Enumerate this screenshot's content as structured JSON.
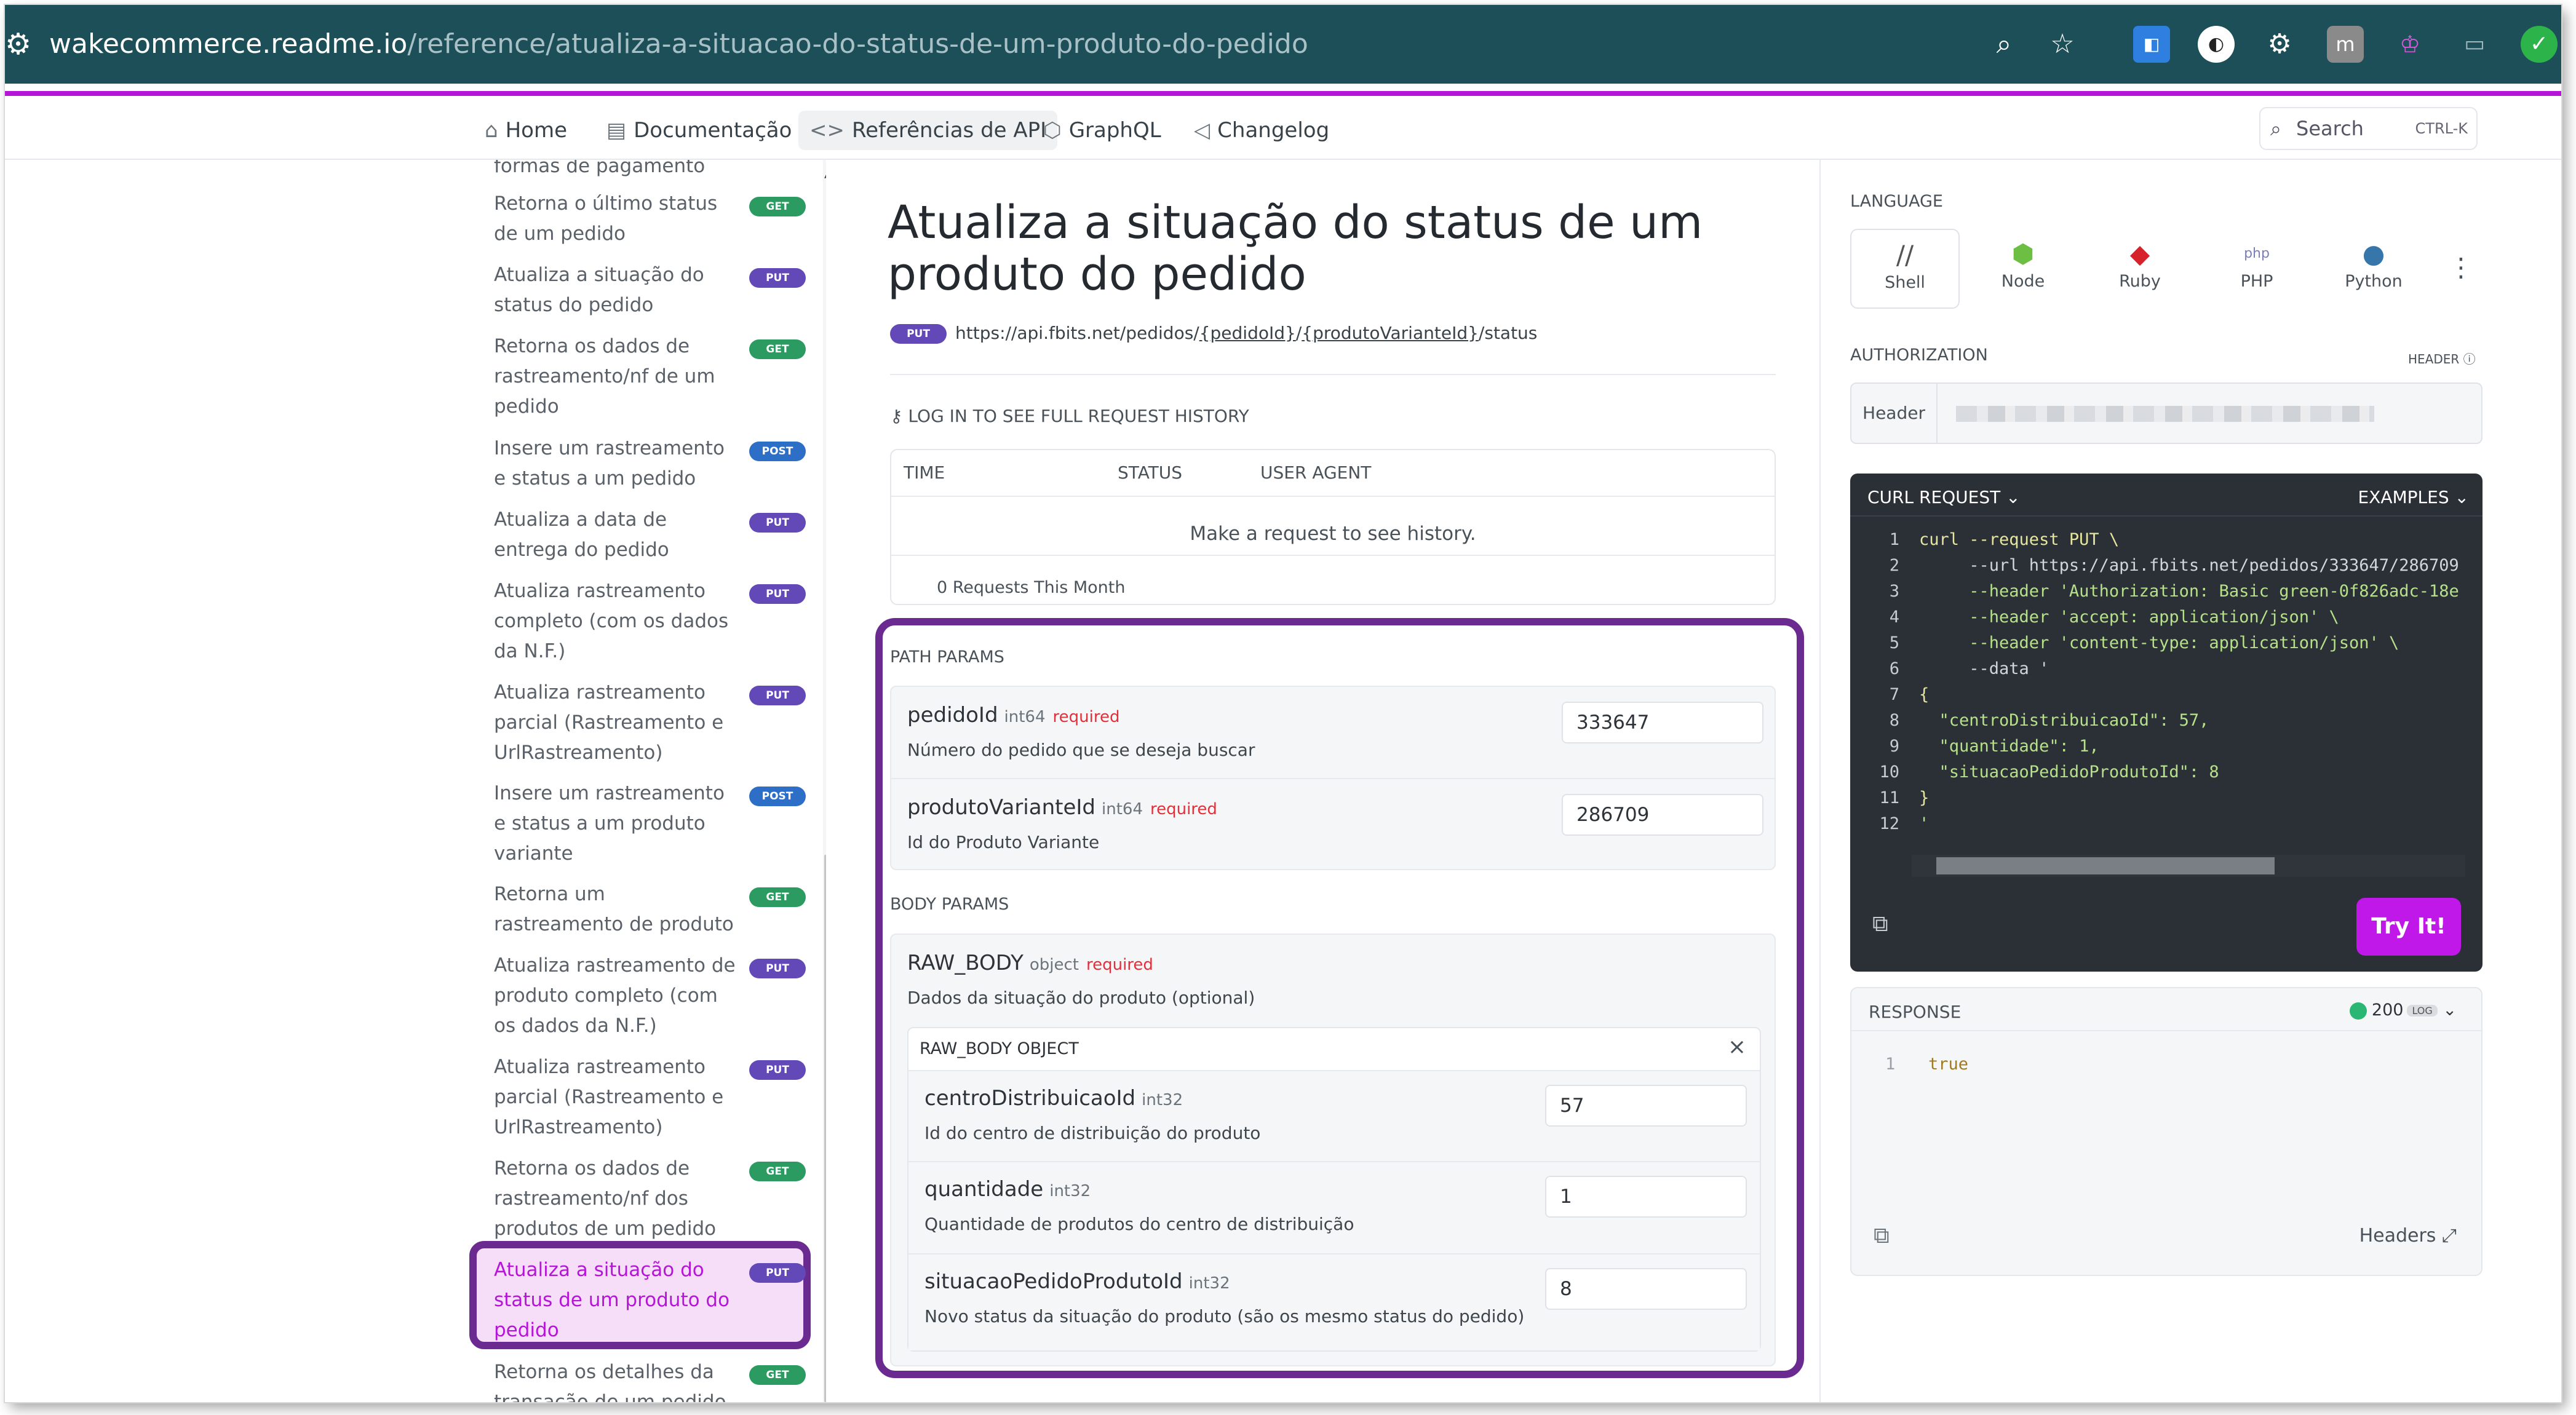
{
  "browser": {
    "url_host": "wakecommerce.readme.io",
    "url_path": "/reference/atualiza-a-situacao-do-status-de-um-produto-do-pedido"
  },
  "nav": {
    "home": "Home",
    "docs": "Documentação",
    "api": "Referências de API",
    "graphql": "GraphQL",
    "changelog": "Changelog",
    "search": "Search",
    "shortcut": "CTRL-K"
  },
  "sidebar": {
    "items": [
      {
        "label": "formas de pagamento",
        "badge": ""
      },
      {
        "label": "Retorna o último status de um pedido",
        "badge": "GET"
      },
      {
        "label": "Atualiza a situação do status do pedido",
        "badge": "PUT"
      },
      {
        "label": "Retorna os dados de rastreamento/nf de um pedido",
        "badge": "GET"
      },
      {
        "label": "Insere um rastreamento e status a um pedido",
        "badge": "POST"
      },
      {
        "label": "Atualiza a data de entrega do pedido",
        "badge": "PUT"
      },
      {
        "label": "Atualiza rastreamento completo (com os dados da N.F.)",
        "badge": "PUT"
      },
      {
        "label": "Atualiza rastreamento parcial (Rastreamento e UrlRastreamento)",
        "badge": "PUT"
      },
      {
        "label": "Insere um rastreamento e status a um produto variante",
        "badge": "POST"
      },
      {
        "label": "Retorna um rastreamento de produto",
        "badge": "GET"
      },
      {
        "label": "Atualiza rastreamento de produto completo (com os dados da N.F.)",
        "badge": "PUT"
      },
      {
        "label": "Atualiza rastreamento parcial (Rastreamento e UrlRastreamento)",
        "badge": "PUT"
      },
      {
        "label": "Retorna os dados de rastreamento/nf dos produtos de um pedido",
        "badge": "GET"
      },
      {
        "label": "Atualiza a situação do status de um produto do pedido",
        "badge": "PUT"
      },
      {
        "label": "Retorna os detalhes da transação de um pedido",
        "badge": "GET"
      }
    ]
  },
  "main": {
    "title": "Atualiza a situação do status de um produto do pedido",
    "method": "PUT",
    "url_base": "https://api.fbits.net/pedidos/",
    "url_p1": "{pedidoId}",
    "url_sep": "/",
    "url_p2": "{produtoVarianteId}",
    "url_end": "/status",
    "login_notice": "LOG IN TO SEE FULL REQUEST HISTORY",
    "history": {
      "col_time": "TIME",
      "col_status": "STATUS",
      "col_agent": "USER AGENT",
      "empty": "Make a request to see history.",
      "count": "0 Requests This Month"
    },
    "path_params_label": "PATH PARAMS",
    "path_params": [
      {
        "name": "pedidoId",
        "type": "int64",
        "req": "required",
        "desc": "Número do pedido que se deseja buscar",
        "value": "333647"
      },
      {
        "name": "produtoVarianteId",
        "type": "int64",
        "req": "required",
        "desc": "Id do Produto Variante",
        "value": "286709"
      }
    ],
    "body_params_label": "BODY PARAMS",
    "raw_body": {
      "name": "RAW_BODY",
      "type": "object",
      "req": "required",
      "desc": "Dados da situação do produto (optional)",
      "object_label": "RAW_BODY OBJECT"
    },
    "body_fields": [
      {
        "name": "centroDistribuicaoId",
        "type": "int32",
        "desc": "Id do centro de distribuição do produto",
        "value": "57"
      },
      {
        "name": "quantidade",
        "type": "int32",
        "desc": "Quantidade de produtos do centro de distribuição",
        "value": "1"
      },
      {
        "name": "situacaoPedidoProdutoId",
        "type": "int32",
        "desc": "Novo status da situação do produto (são os mesmo status do pedido)",
        "value": "8"
      }
    ]
  },
  "right": {
    "language_label": "LANGUAGE",
    "languages": [
      "Shell",
      "Node",
      "Ruby",
      "PHP",
      "Python"
    ],
    "auth_label": "AUTHORIZATION",
    "auth_header_tag": "HEADER",
    "auth_key": "Header",
    "curl_title": "CURL REQUEST",
    "examples": "EXAMPLES",
    "code": [
      "curl --request PUT \\",
      "     --url https://api.fbits.net/pedidos/333647/286709",
      "     --header 'Authorization: Basic green-0f826adc-18e",
      "     --header 'accept: application/json' \\",
      "     --header 'content-type: application/json' \\",
      "     --data '",
      "{",
      "  \"centroDistribuicaoId\": 57,",
      "  \"quantidade\": 1,",
      "  \"situacaoPedidoProdutoId\": 8",
      "}",
      "'"
    ],
    "try_it": "Try It!",
    "response_label": "RESPONSE",
    "response_status": "200",
    "response_log": "LOG",
    "response_value": "true",
    "headers_label": "Headers"
  }
}
